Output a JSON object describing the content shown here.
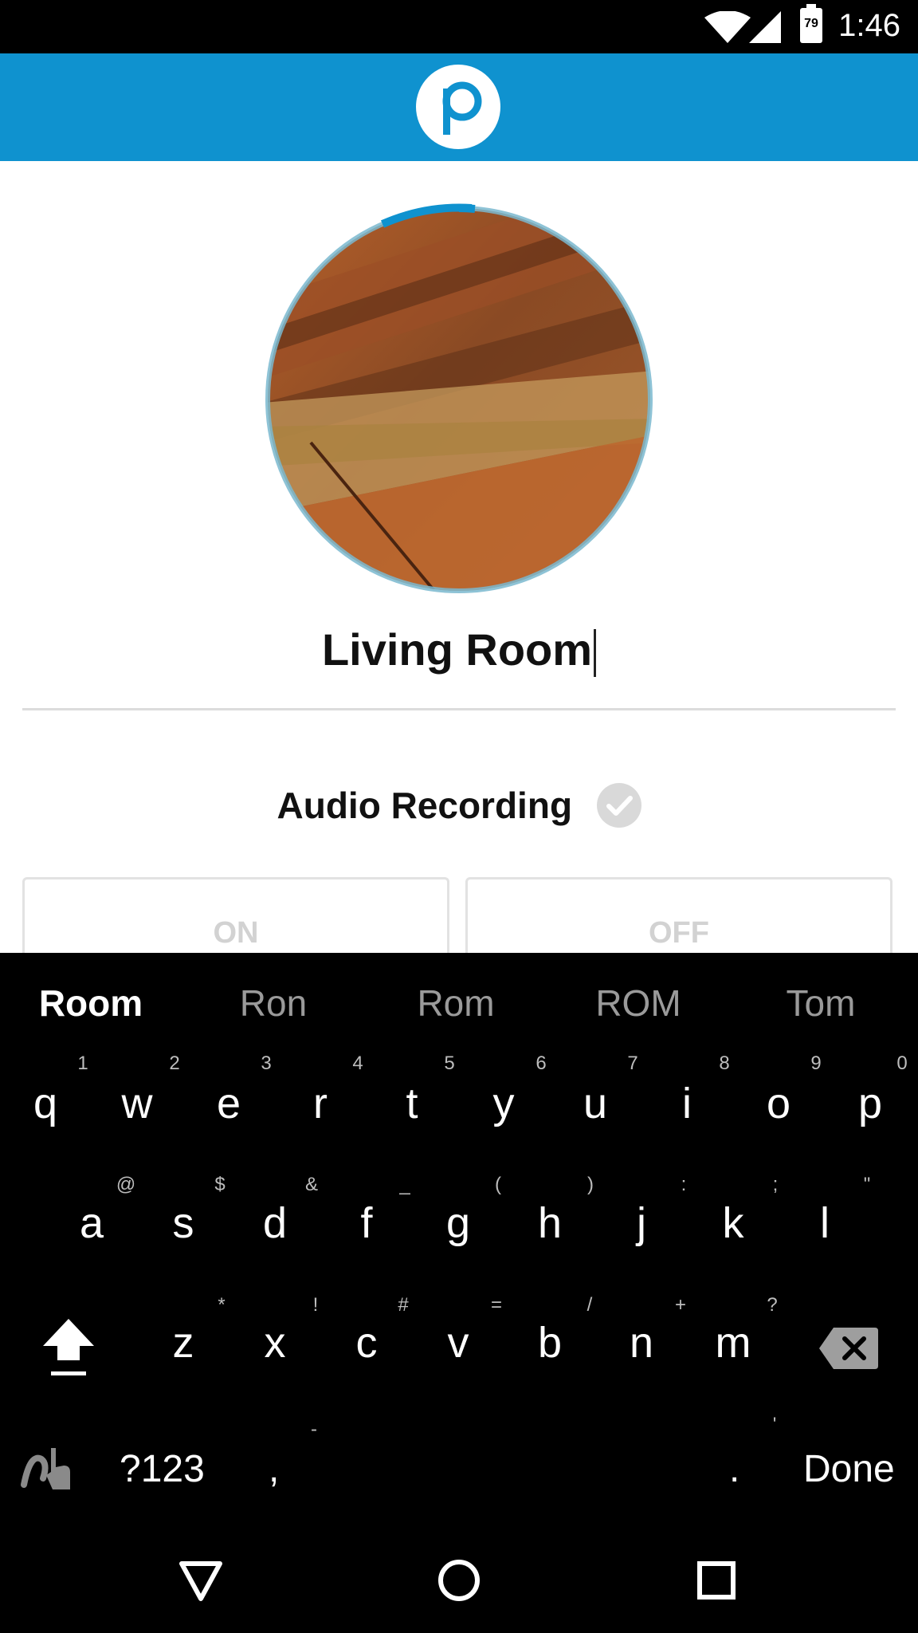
{
  "status_bar": {
    "time": "1:46",
    "battery_level": "79",
    "icons": [
      "wifi-icon",
      "signal-icon",
      "battery-icon"
    ]
  },
  "app_bar": {
    "logo_icon": "p-logo-icon",
    "color": "#0f92cf"
  },
  "room": {
    "name_value": "Living Room",
    "photo": "wood-floor-photo"
  },
  "audio": {
    "label": "Audio Recording",
    "on_label": "ON",
    "off_label": "OFF"
  },
  "keyboard": {
    "suggestions": [
      "Room",
      "Ron",
      "Rom",
      "ROM",
      "Tom"
    ],
    "row1": [
      "q",
      "w",
      "e",
      "r",
      "t",
      "y",
      "u",
      "i",
      "o",
      "p"
    ],
    "row1_hints": [
      "1",
      "2",
      "3",
      "4",
      "5",
      "6",
      "7",
      "8",
      "9",
      "0"
    ],
    "row2": [
      "a",
      "s",
      "d",
      "f",
      "g",
      "h",
      "j",
      "k",
      "l"
    ],
    "row2_hints": [
      "@",
      "$",
      "&",
      "_",
      "(",
      ")",
      ":",
      ";",
      "\""
    ],
    "row3": [
      "z",
      "x",
      "c",
      "v",
      "b",
      "n",
      "m"
    ],
    "row3_hints": [
      "*",
      "!",
      "#",
      "=",
      "/",
      "+",
      "?"
    ],
    "symbols_label": "?123",
    "comma": ",",
    "comma_hint": "-",
    "period": ".",
    "period_hint": "'",
    "done_label": "Done"
  },
  "nav_bar": {
    "icons": [
      "back-icon",
      "home-icon",
      "recents-icon"
    ]
  }
}
